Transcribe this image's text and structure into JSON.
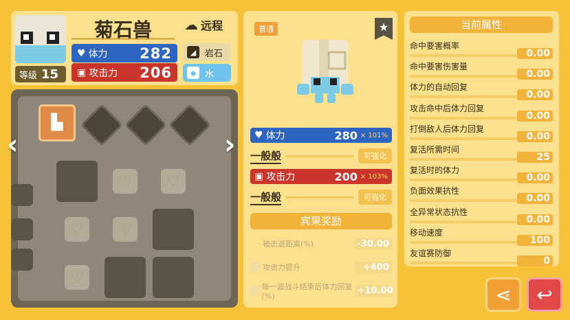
{
  "pokemon": {
    "name": "菊石兽",
    "role": "远程",
    "level_label": "等级",
    "level": "15",
    "hp_label": "体力",
    "hp": "282",
    "atk_label": "攻击力",
    "atk": "206",
    "types": [
      "岩石",
      "水"
    ]
  },
  "detail": {
    "badge": "普通",
    "hp_label": "体力",
    "hp": "280",
    "hp_pct": "× 101%",
    "hp_grade": "一般般",
    "atk_label": "攻击力",
    "atk": "200",
    "atk_pct": "× 103%",
    "atk_grade": "一般般",
    "upgrade_label": "可强化",
    "bonus_title": "宾果奖励",
    "bonuses": [
      {
        "label": "被击退距离(%)",
        "value": "-30.00"
      },
      {
        "label": "攻击力提升",
        "value": "+400"
      },
      {
        "label": "每一波战斗结束后体力回复(%)",
        "value": "+10.00"
      }
    ]
  },
  "attributes": {
    "title": "当前属性",
    "items": [
      {
        "label": "命中要害概率",
        "value": "0.00"
      },
      {
        "label": "命中要害伤害量",
        "value": "0.00"
      },
      {
        "label": "体力的自动回复",
        "value": "0.00"
      },
      {
        "label": "攻击命中后体力回复",
        "value": "0.00"
      },
      {
        "label": "打倒敌人后体力回复",
        "value": "0.00"
      },
      {
        "label": "复活所需时间",
        "value": "25"
      },
      {
        "label": "复活时的体力",
        "value": "0.00"
      },
      {
        "label": "负面效果抗性",
        "value": "0.00"
      },
      {
        "label": "全异常状态抗性",
        "value": "0.00"
      },
      {
        "label": "移动速度",
        "value": "100"
      },
      {
        "label": "友谊赛防御",
        "value": "0"
      }
    ]
  },
  "colors": {
    "hp": "#2e64c2",
    "atk": "#c9352a",
    "accent": "#f2b33a"
  }
}
